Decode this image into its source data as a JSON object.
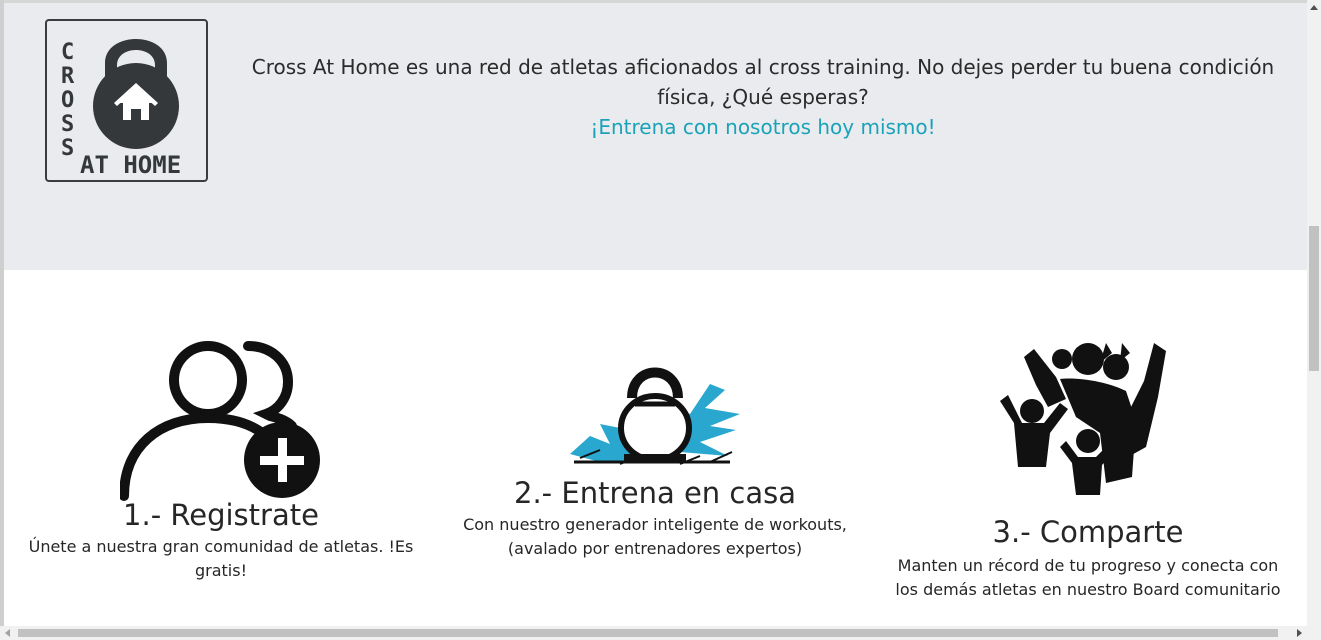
{
  "hero": {
    "logo": {
      "word_vertical": "CROSS",
      "word_bottom": "AT HOME"
    },
    "description": "Cross At Home es una red de atletas aficionados al cross training. No dejes perder tu buena condición física, ¿Qué esperas?",
    "cta": "¡Entrena con nosotros hoy mismo!",
    "cta_color": "#1aa3b8",
    "background": "#e9ebee"
  },
  "steps": [
    {
      "icon": "add-user-icon",
      "title": "1.- Registrate",
      "description": "Únete a nuestra gran comunidad de atletas. !Es gratis!"
    },
    {
      "icon": "kettlebell-splash-icon",
      "title": "2.- Entrena en casa",
      "description": "Con nuestro generador inteligente de workouts, (avalado por entrenadores expertos)"
    },
    {
      "icon": "community-group-icon",
      "title": "3.- Comparte",
      "description": "Manten un récord de tu progreso y conecta con los demás atletas en nuestro Board comunitario"
    }
  ]
}
